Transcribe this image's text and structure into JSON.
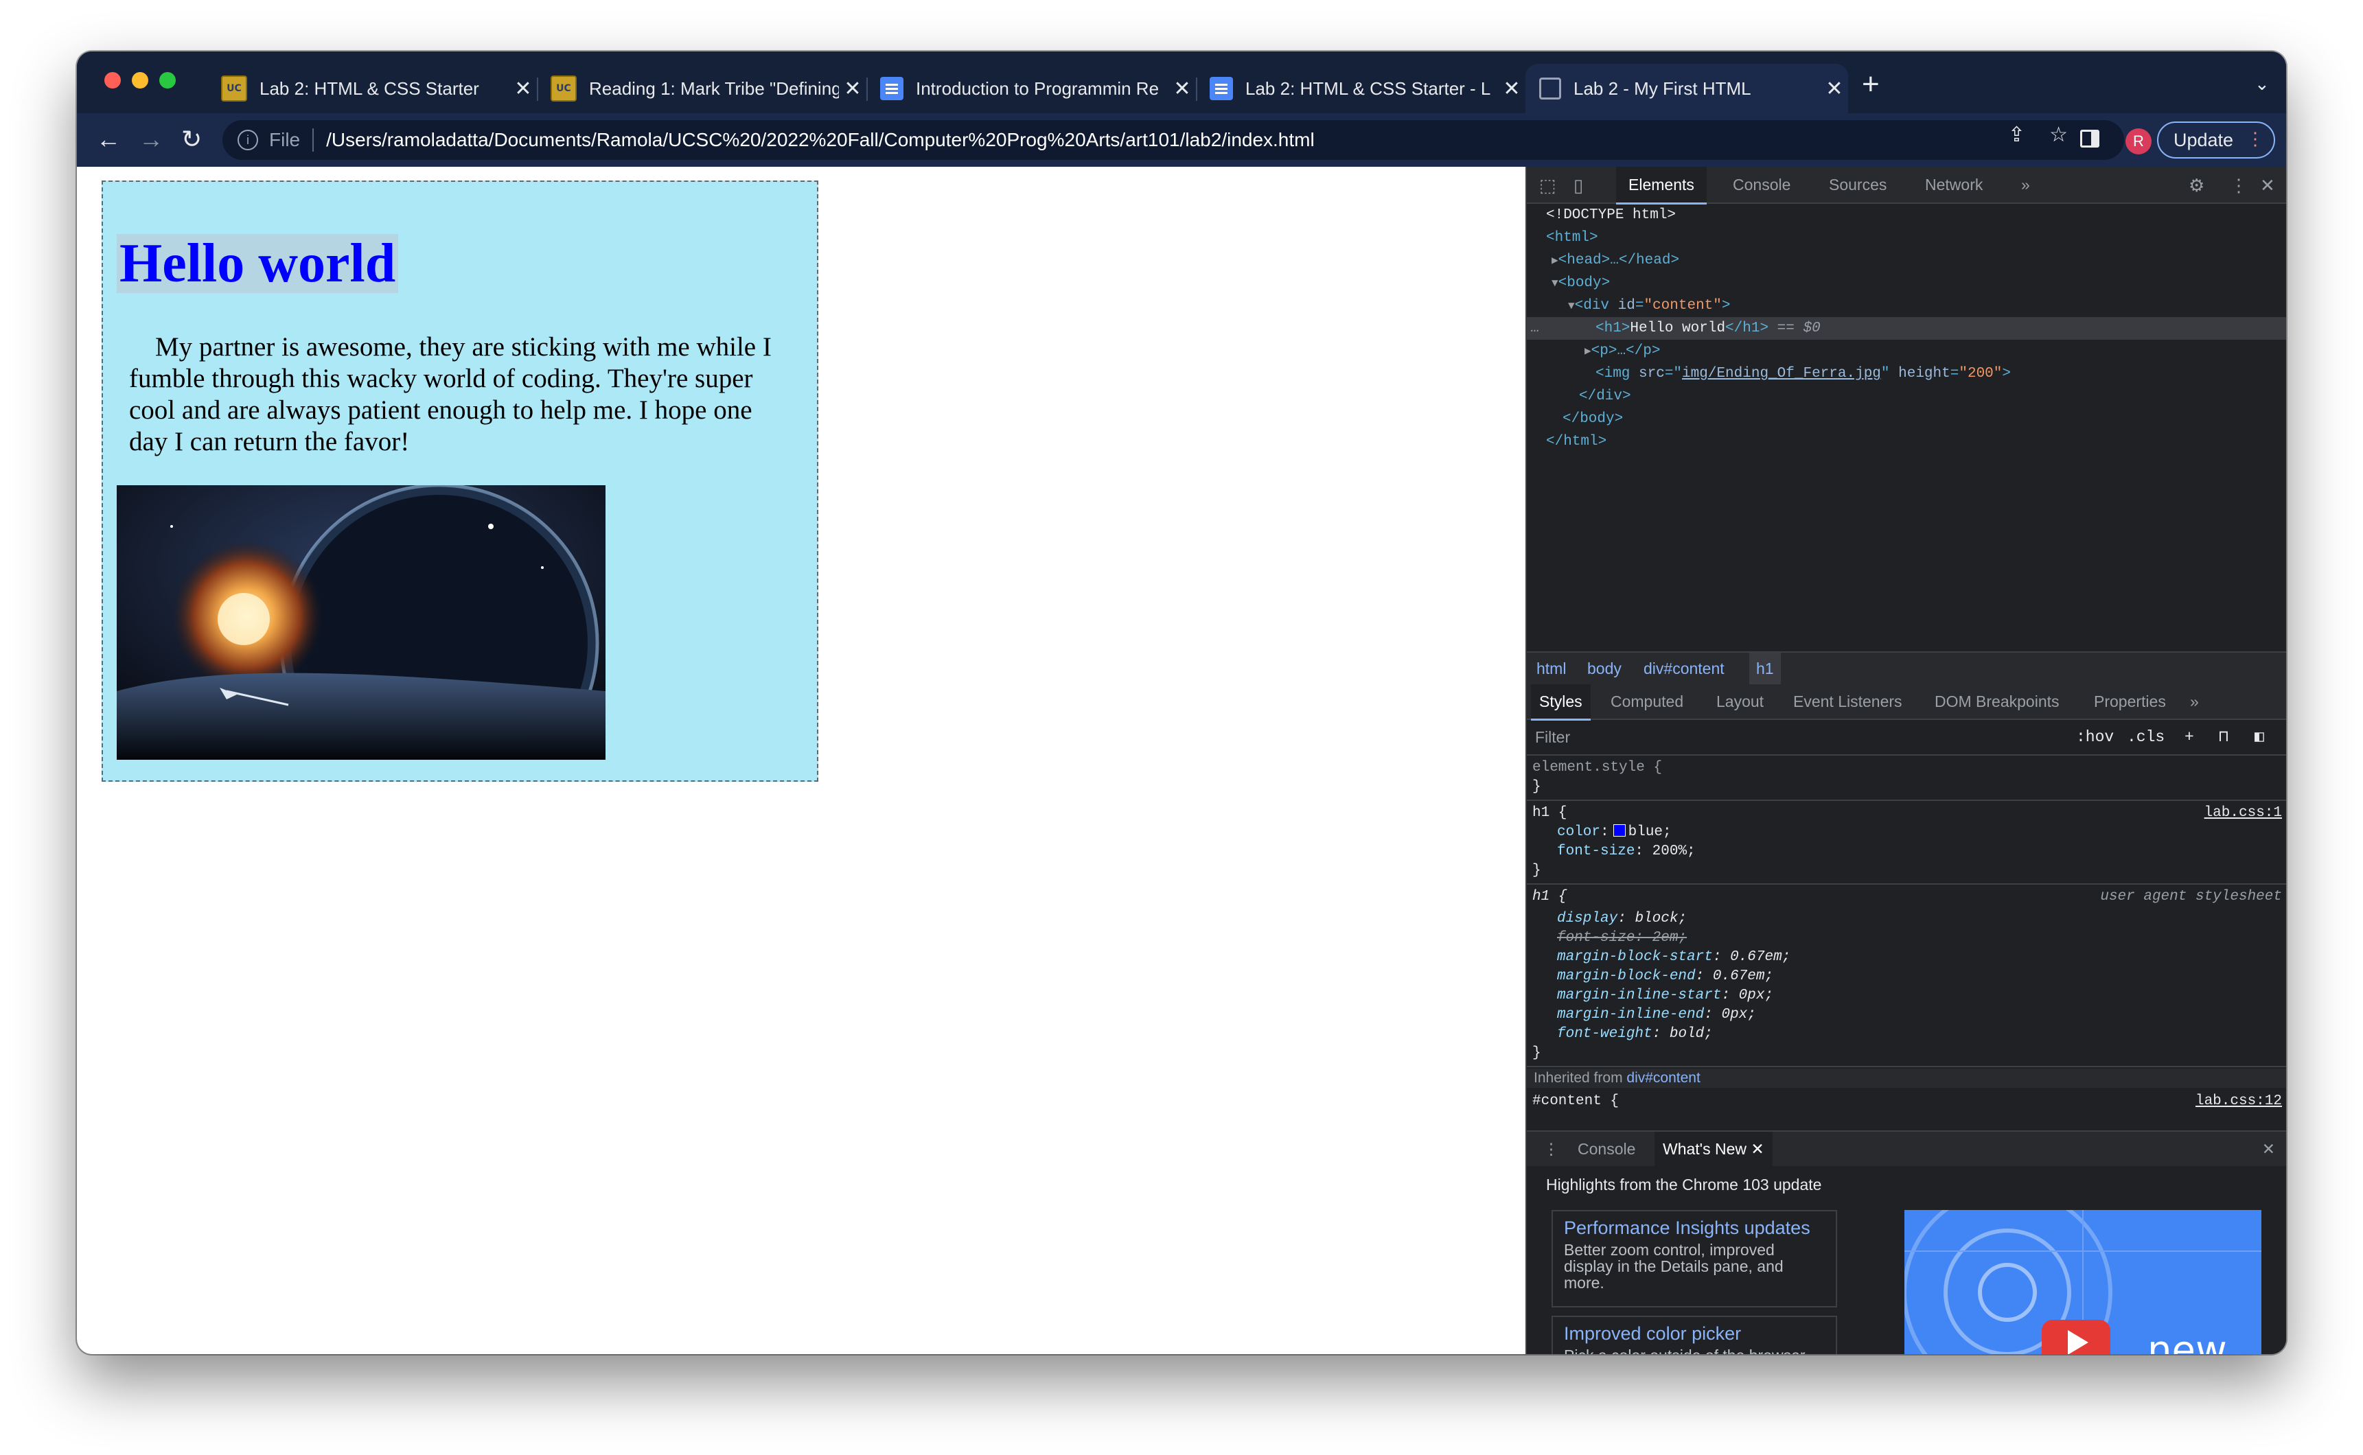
{
  "window": {
    "tabs": [
      {
        "title": "Lab 2: HTML & CSS Starter",
        "icon": "ucsc-icon"
      },
      {
        "title": "Reading 1: Mark Tribe \"Defining",
        "icon": "ucsc-icon"
      },
      {
        "title": "Introduction to Programmin Re",
        "icon": "doc-icon"
      },
      {
        "title": "Lab 2: HTML & CSS Starter - L",
        "icon": "doc-icon"
      },
      {
        "title": "Lab 2 - My First HTML",
        "icon": "globe-icon"
      }
    ],
    "new_tab": "+",
    "tab_search": "⌄",
    "close_glyph": "✕"
  },
  "toolbar": {
    "scheme": "File",
    "url": "/Users/ramoladatta/Documents/Ramola/UCSC%20/2022%20Fall/Computer%20Prog%20Arts/art101/lab2/index.html",
    "avatar_initial": "R",
    "update_label": "Update"
  },
  "page": {
    "heading": "Hello world",
    "paragraph": "My partner is awesome, they are sticking with me while I fumble through this wacky world of coding. They're super cool and are always patient enough to help me. I hope one day I can return the favor!",
    "image_alt": "Ending Of Ferra"
  },
  "devtools": {
    "tabs": [
      "Elements",
      "Console",
      "Sources",
      "Network"
    ],
    "more": "»",
    "dom": {
      "doctype": "<!DOCTYPE html>",
      "html_open": "<html>",
      "head": "<head>…</head>",
      "body_open": "<body>",
      "div_open_tag": "<div ",
      "div_attr": "id",
      "div_val": "\"content\"",
      "h1_open": "<h1>",
      "h1_text": "Hello world",
      "h1_close": "</h1>",
      "h1_marker": " == $0",
      "p_line": "<p>…</p>",
      "img_open": "<img ",
      "img_src_attr": "src",
      "img_src_val": "img/Ending_Of_Ferra.jpg",
      "img_h_attr": "height",
      "img_h_val": "\"200\"",
      "div_close": "</div>",
      "body_close": "</body>",
      "html_close": "</html>",
      "ellipsis": "…"
    },
    "breadcrumbs": [
      "html",
      "body",
      "div#content",
      "h1"
    ],
    "style_tabs": [
      "Styles",
      "Computed",
      "Layout",
      "Event Listeners",
      "DOM Breakpoints",
      "Properties"
    ],
    "filter_placeholder": "Filter",
    "hov": ":hov",
    "cls": ".cls",
    "rules": {
      "element_style": "element.style {",
      "close_brace": "}",
      "h1_sel": "h1 {",
      "h1_src": "lab.css:1",
      "color_prop": "color",
      "color_val": "blue;",
      "fontsize_prop": "font-size",
      "fontsize_val": "200%;",
      "ua_sel": "h1 {",
      "ua_src": "user agent stylesheet",
      "ua_props": [
        {
          "p": "display",
          "v": "block;"
        },
        {
          "p": "font-size",
          "v": "2em;"
        },
        {
          "p": "margin-block-start",
          "v": "0.67em;"
        },
        {
          "p": "margin-block-end",
          "v": "0.67em;"
        },
        {
          "p": "margin-inline-start",
          "v": "0px;"
        },
        {
          "p": "margin-inline-end",
          "v": "0px;"
        },
        {
          "p": "font-weight",
          "v": "bold;"
        }
      ],
      "inherited_label": "Inherited from ",
      "inherited_target": "div#content",
      "content_sel": "#content {",
      "content_src": "lab.css:12"
    },
    "drawer": {
      "tabs": [
        "Console",
        "What's New"
      ],
      "highlights": "Highlights from the Chrome 103 update",
      "cards": [
        {
          "title": "Performance Insights updates",
          "desc": "Better zoom control, improved display in the Details pane, and more."
        },
        {
          "title": "Improved color picker",
          "desc": "Pick a color outside of the browser window with the new"
        }
      ],
      "video_text": "new"
    }
  }
}
